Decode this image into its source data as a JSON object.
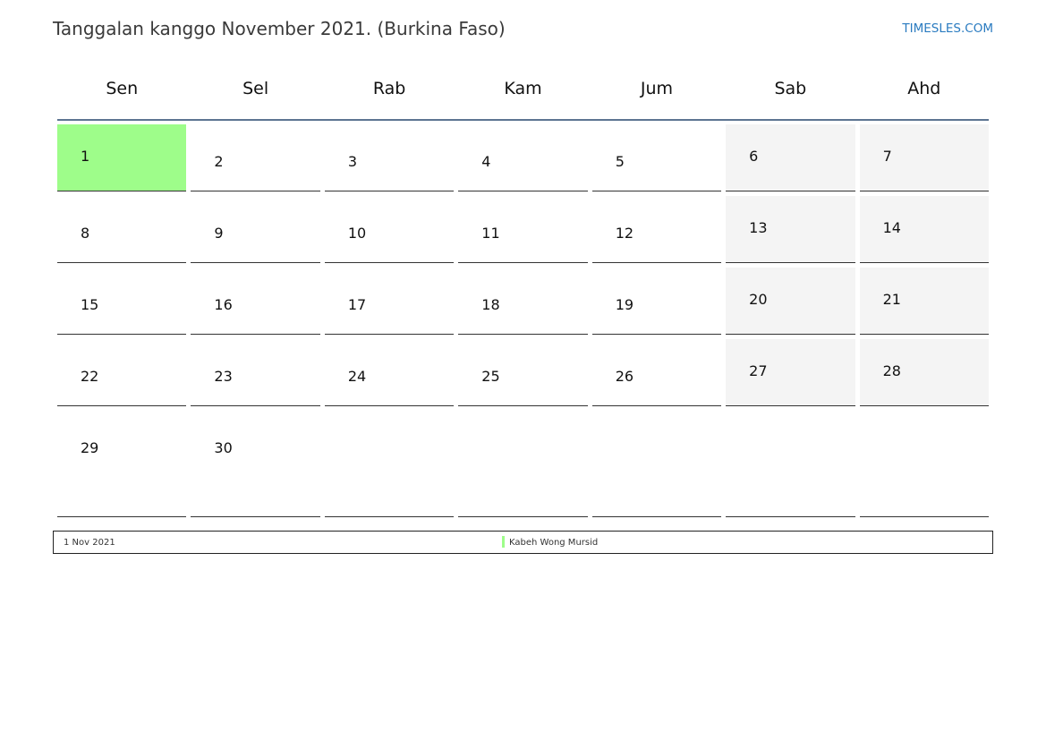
{
  "header": {
    "title": "Tanggalan kanggo November 2021. (Burkina Faso)",
    "site_link": "TIMESLES.COM"
  },
  "weekdays": [
    "Sen",
    "Sel",
    "Rab",
    "Kam",
    "Jum",
    "Sab",
    "Ahd"
  ],
  "weeks": [
    [
      {
        "day": "1",
        "type": "holiday"
      },
      {
        "day": "2",
        "type": "weekday"
      },
      {
        "day": "3",
        "type": "weekday"
      },
      {
        "day": "4",
        "type": "weekday"
      },
      {
        "day": "5",
        "type": "weekday"
      },
      {
        "day": "6",
        "type": "weekend"
      },
      {
        "day": "7",
        "type": "weekend"
      }
    ],
    [
      {
        "day": "8",
        "type": "weekday"
      },
      {
        "day": "9",
        "type": "weekday"
      },
      {
        "day": "10",
        "type": "weekday"
      },
      {
        "day": "11",
        "type": "weekday"
      },
      {
        "day": "12",
        "type": "weekday"
      },
      {
        "day": "13",
        "type": "weekend"
      },
      {
        "day": "14",
        "type": "weekend"
      }
    ],
    [
      {
        "day": "15",
        "type": "weekday"
      },
      {
        "day": "16",
        "type": "weekday"
      },
      {
        "day": "17",
        "type": "weekday"
      },
      {
        "day": "18",
        "type": "weekday"
      },
      {
        "day": "19",
        "type": "weekday"
      },
      {
        "day": "20",
        "type": "weekend"
      },
      {
        "day": "21",
        "type": "weekend"
      }
    ],
    [
      {
        "day": "22",
        "type": "weekday"
      },
      {
        "day": "23",
        "type": "weekday"
      },
      {
        "day": "24",
        "type": "weekday"
      },
      {
        "day": "25",
        "type": "weekday"
      },
      {
        "day": "26",
        "type": "weekday"
      },
      {
        "day": "27",
        "type": "weekend"
      },
      {
        "day": "28",
        "type": "weekend"
      }
    ],
    [
      {
        "day": "29",
        "type": "weekday"
      },
      {
        "day": "30",
        "type": "weekday"
      },
      {
        "day": "",
        "type": "empty"
      },
      {
        "day": "",
        "type": "empty"
      },
      {
        "day": "",
        "type": "empty"
      },
      {
        "day": "",
        "type": "empty"
      },
      {
        "day": "",
        "type": "empty"
      }
    ]
  ],
  "legend": {
    "date": "1 Nov 2021",
    "holiday_name": "Kabeh Wong Mursid"
  },
  "colors": {
    "holiday": "#9efd8a",
    "weekend": "#f4f4f4",
    "header_rule": "#5d7592",
    "link": "#2a7bc0"
  }
}
